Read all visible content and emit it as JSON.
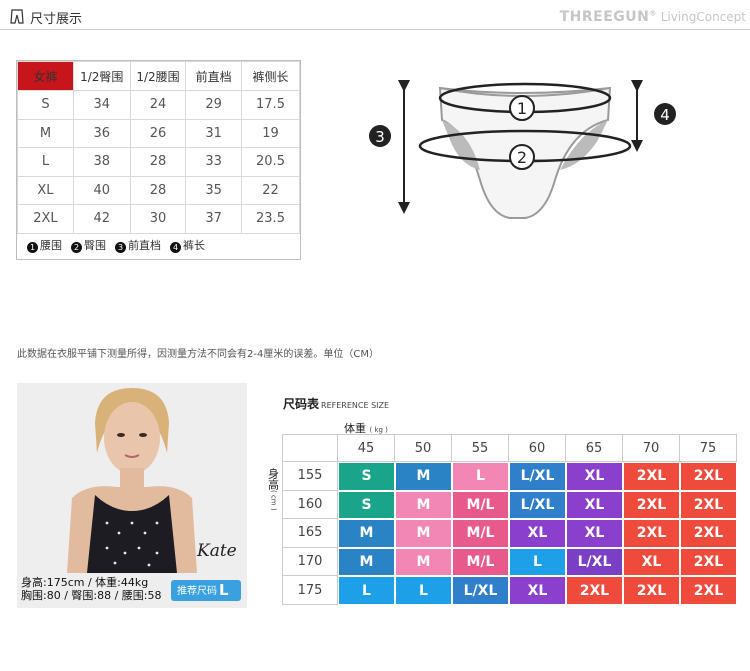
{
  "header": {
    "title": "尺寸展示",
    "brand": "THREEGUN",
    "brand_suffix": " LivingConcept",
    "trademark": "®"
  },
  "size_table": {
    "headers": [
      "女裤",
      "1/2臀围",
      "1/2腰围",
      "前直档",
      "裤侧长"
    ],
    "rows": [
      [
        "S",
        "34",
        "24",
        "29",
        "17.5"
      ],
      [
        "M",
        "36",
        "26",
        "31",
        "19"
      ],
      [
        "L",
        "38",
        "28",
        "33",
        "20.5"
      ],
      [
        "XL",
        "40",
        "28",
        "35",
        "22"
      ],
      [
        "2XL",
        "42",
        "30",
        "37",
        "23.5"
      ]
    ],
    "legend": [
      {
        "num": "1",
        "label": "腰围"
      },
      {
        "num": "2",
        "label": "臀围"
      },
      {
        "num": "3",
        "label": "前直档"
      },
      {
        "num": "4",
        "label": "裤长"
      }
    ]
  },
  "diagram": {
    "markers": [
      "1",
      "2",
      "3",
      "4"
    ]
  },
  "note": "此数据在衣服平铺下测量所得，因测量方法不同会有2-4厘米的误差。单位（CM）",
  "model": {
    "name": "Kate",
    "line1": "身高:175cm / 体重:44kg",
    "line2": "胸围:80 / 臀围:88 / 腰围:58",
    "rec_label": "推荐尺码",
    "rec_size": "L"
  },
  "reference": {
    "title": "尺码表",
    "title_en": "REFERENCE SIZE",
    "weight_label": "体重",
    "weight_unit": "( kg )",
    "height_label": "身高",
    "height_unit": "( cm )",
    "weights": [
      "45",
      "50",
      "55",
      "60",
      "65",
      "70",
      "75"
    ],
    "heights": [
      "155",
      "160",
      "165",
      "170",
      "175"
    ],
    "cells": [
      [
        "S",
        "M",
        "L",
        "L/XL",
        "XL",
        "2XL",
        "2XL"
      ],
      [
        "S",
        "M",
        "M/L",
        "L/XL",
        "XL",
        "2XL",
        "2XL"
      ],
      [
        "M",
        "M",
        "M/L",
        "XL",
        "XL",
        "2XL",
        "2XL"
      ],
      [
        "M",
        "M",
        "M/L",
        "L",
        "L/XL",
        "XL",
        "2XL"
      ],
      [
        "L",
        "L",
        "L/XL",
        "XL",
        "2XL",
        "2XL",
        "2XL"
      ]
    ],
    "colors": {
      "S": "#1aa58a",
      "M": "#2a83c4",
      "M_light": "#f287b5",
      "L": "#f287b5",
      "L_blue": "#1ea0e8",
      "ML": "#e85a8c",
      "LXL": "#2f7fca",
      "XL": "#8a40cc",
      "XL_alt": "#7b3fc6",
      "2XL": "#ee4b3c"
    }
  }
}
